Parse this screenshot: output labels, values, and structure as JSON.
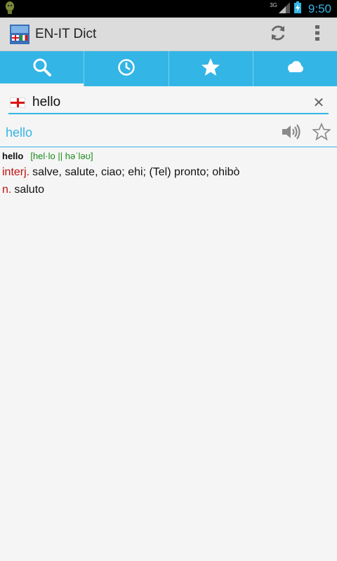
{
  "status": {
    "time": "9:50",
    "network": "3G"
  },
  "app": {
    "title": "EN-IT Dict"
  },
  "tabs": [
    {
      "icon": "search-icon",
      "active": true
    },
    {
      "icon": "history-clock-icon",
      "active": false
    },
    {
      "icon": "star-icon",
      "active": false
    },
    {
      "icon": "cloud-icon",
      "active": false
    }
  ],
  "search": {
    "value": "hello",
    "language_flag": "english-flag-icon"
  },
  "result": {
    "word": "hello"
  },
  "entry": {
    "head_word": "hello",
    "phonetic": "[hel·lo || həˈləʊ]",
    "senses": [
      {
        "pos": "interj.",
        "text": "salve, salute, ciao; ehi; (Tel) pronto; ohibò"
      },
      {
        "pos": "n.",
        "text": "saluto"
      }
    ]
  },
  "colors": {
    "accent": "#33b5e5",
    "pos": "#c01010",
    "phonetic": "#1a8a1a"
  }
}
